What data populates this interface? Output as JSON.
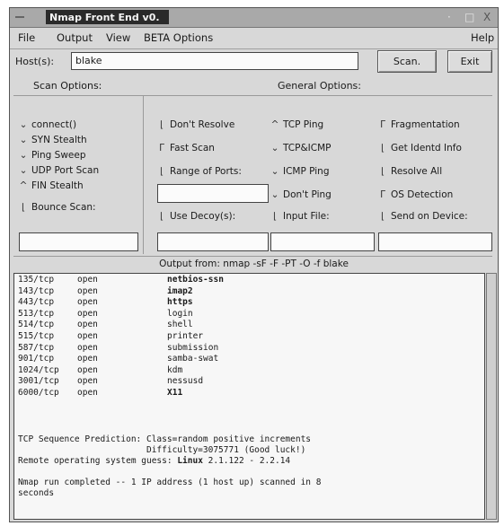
{
  "window": {
    "title": "Nmap Front End v0.",
    "menu_glyph": "ꟷ≡",
    "btn_min": "·",
    "btn_max": "□",
    "btn_close": "X"
  },
  "menu": {
    "items": [
      "File",
      "Output",
      "View",
      "BETA Options"
    ],
    "help": "Help"
  },
  "host": {
    "label": "Host(s):",
    "value": "blake"
  },
  "buttons": {
    "scan": "Scan.",
    "exit": "Exit"
  },
  "sections": {
    "scan_options": "Scan Options:",
    "general_options": "General Options:"
  },
  "scan_options": [
    {
      "label": "connect()",
      "selected": false
    },
    {
      "label": "SYN Stealth",
      "selected": false
    },
    {
      "label": "Ping Sweep",
      "selected": false
    },
    {
      "label": "UDP Port Scan",
      "selected": false
    },
    {
      "label": "FIN Stealth",
      "selected": true
    }
  ],
  "bounce_scan": {
    "label": "Bounce Scan:",
    "checked": false
  },
  "col2": [
    {
      "label": "Don't Resolve",
      "checked": false
    },
    {
      "label": "Fast Scan",
      "checked": true
    },
    {
      "label": "Range of Ports:",
      "checked": false
    }
  ],
  "use_decoys": {
    "label": "Use Decoy(s):",
    "checked": false
  },
  "col3": [
    {
      "label": "TCP Ping",
      "selected": true
    },
    {
      "label": "TCP&ICMP",
      "selected": false
    },
    {
      "label": "ICMP Ping",
      "selected": false
    },
    {
      "label": "Don't Ping",
      "selected": false
    }
  ],
  "input_file": {
    "label": "Input File:",
    "checked": false
  },
  "col4": [
    {
      "label": "Fragmentation",
      "checked": true
    },
    {
      "label": "Get Identd Info",
      "checked": false
    },
    {
      "label": "Resolve All",
      "checked": false
    },
    {
      "label": "OS Detection",
      "checked": true
    }
  ],
  "send_on_device": {
    "label": "Send on Device:",
    "checked": false
  },
  "output": {
    "command_line": "Output from:  nmap -sF  -F -PT -O -f blake",
    "ports": [
      {
        "port": "135/tcp",
        "state": "open",
        "service": "netbios-ssn",
        "bold": true
      },
      {
        "port": "143/tcp",
        "state": "open",
        "service": "imap2",
        "bold": true
      },
      {
        "port": "443/tcp",
        "state": "open",
        "service": "https",
        "bold": true
      },
      {
        "port": "513/tcp",
        "state": "open",
        "service": "login",
        "bold": false
      },
      {
        "port": "514/tcp",
        "state": "open",
        "service": "shell",
        "bold": false
      },
      {
        "port": "515/tcp",
        "state": "open",
        "service": "printer",
        "bold": false
      },
      {
        "port": "587/tcp",
        "state": "open",
        "service": "submission",
        "bold": false
      },
      {
        "port": "901/tcp",
        "state": "open",
        "service": "samba-swat",
        "bold": false
      },
      {
        "port": "1024/tcp",
        "state": "open",
        "service": "kdm",
        "bold": false
      },
      {
        "port": "3001/tcp",
        "state": "open",
        "service": "nessusd",
        "bold": false
      },
      {
        "port": "6000/tcp",
        "state": "open",
        "service": "X11",
        "bold": true
      }
    ],
    "tcp_seq": "TCP Sequence Prediction: Class=random positive increments",
    "difficulty": "                         Difficulty=3075771 (Good luck!)",
    "os_guess_prefix": "Remote operating system guess: ",
    "os_guess_bold": "Linux",
    "os_guess_suffix": " 2.1.122 - 2.2.14",
    "completed_1": "Nmap run completed -- 1 IP address (1 host up) scanned in 8",
    "completed_2": "seconds"
  }
}
